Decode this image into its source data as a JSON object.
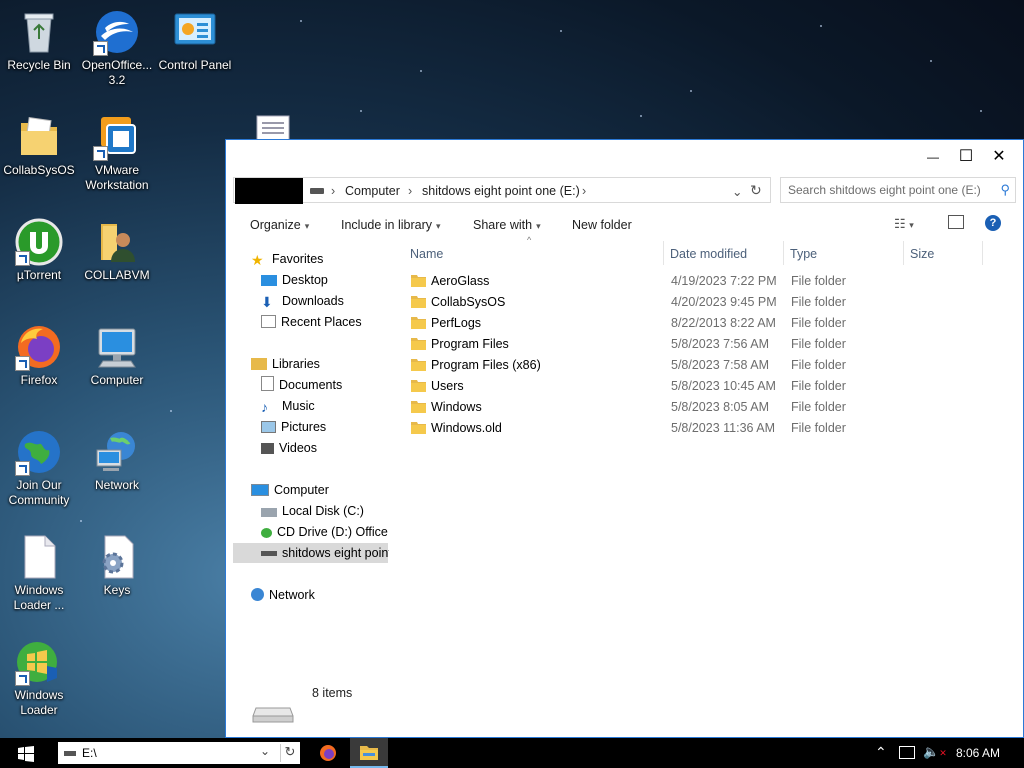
{
  "desktop": {
    "icons": [
      {
        "id": "recycle-bin",
        "label": "Recycle Bin"
      },
      {
        "id": "openoffice",
        "label": "OpenOffice... 3.2"
      },
      {
        "id": "control-panel",
        "label": "Control Panel"
      },
      {
        "id": "collabsysos",
        "label": "CollabSysOS"
      },
      {
        "id": "vmware",
        "label": "VMware Workstation"
      },
      {
        "id": "utorrent",
        "label": "µTorrent"
      },
      {
        "id": "collabvm",
        "label": "COLLABVM"
      },
      {
        "id": "firefox",
        "label": "Firefox"
      },
      {
        "id": "computer",
        "label": "Computer"
      },
      {
        "id": "join-community",
        "label": "Join Our Community"
      },
      {
        "id": "network",
        "label": "Network"
      },
      {
        "id": "windows-loader-file",
        "label": "Windows Loader ..."
      },
      {
        "id": "keys",
        "label": "Keys"
      },
      {
        "id": "windows-loader",
        "label": "Windows Loader"
      }
    ]
  },
  "explorer": {
    "window_buttons": {
      "minimize": "—",
      "maximize": "☐",
      "close": "✕"
    },
    "breadcrumb": [
      "Computer",
      "shitdows eight point one (E:)"
    ],
    "search_placeholder": "Search shitdows eight point one (E:)",
    "toolbar": {
      "organize": "Organize",
      "include": "Include in library",
      "share": "Share with",
      "new_folder": "New folder"
    },
    "nav": {
      "favorites": "Favorites",
      "favorites_items": [
        "Desktop",
        "Downloads",
        "Recent Places"
      ],
      "libraries": "Libraries",
      "libraries_items": [
        "Documents",
        "Music",
        "Pictures",
        "Videos"
      ],
      "computer": "Computer",
      "computer_items": [
        "Local Disk (C:)",
        "CD Drive (D:) OfficeI",
        "shitdows eight point"
      ],
      "network": "Network"
    },
    "columns": {
      "name": "Name",
      "date": "Date modified",
      "type": "Type",
      "size": "Size"
    },
    "files": [
      {
        "name": "AeroGlass",
        "date": "4/19/2023 7:22 PM",
        "type": "File folder"
      },
      {
        "name": "CollabSysOS",
        "date": "4/20/2023 9:45 PM",
        "type": "File folder"
      },
      {
        "name": "PerfLogs",
        "date": "8/22/2013 8:22 AM",
        "type": "File folder"
      },
      {
        "name": "Program Files",
        "date": "5/8/2023 7:56 AM",
        "type": "File folder"
      },
      {
        "name": "Program Files (x86)",
        "date": "5/8/2023 7:58 AM",
        "type": "File folder"
      },
      {
        "name": "Users",
        "date": "5/8/2023 10:45 AM",
        "type": "File folder"
      },
      {
        "name": "Windows",
        "date": "5/8/2023 8:05 AM",
        "type": "File folder"
      },
      {
        "name": "Windows.old",
        "date": "5/8/2023 11:36 AM",
        "type": "File folder"
      }
    ],
    "status": "8 items"
  },
  "taskbar": {
    "address": "E:\\",
    "time": "8:06 AM"
  },
  "colors": {
    "accent": "#2b79d6",
    "folder": "#f5c94c",
    "selected": "#d9d9d9"
  }
}
